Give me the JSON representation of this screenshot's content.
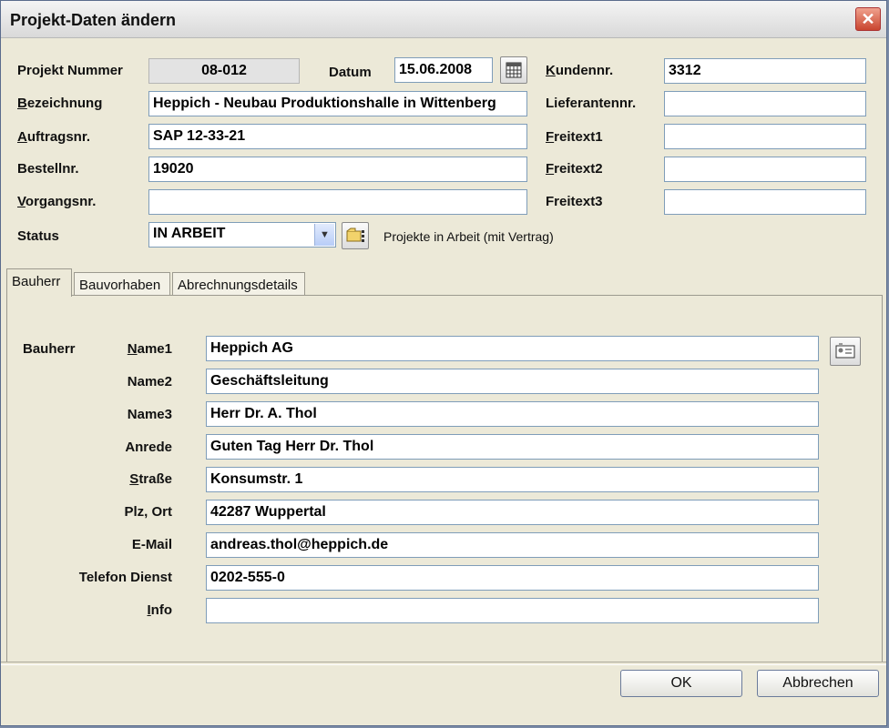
{
  "window": {
    "title": "Projekt-Daten ändern",
    "close_glyph": "✕"
  },
  "project": {
    "nummer_label": "Projekt Nummer",
    "nummer_value": "08-012",
    "datum_label": "Datum",
    "datum_value": "15.06.2008",
    "kundennr_label": "Kundennr.",
    "kundennr_value": "3312",
    "bezeichnung_label": "Bezeichnung",
    "bezeichnung_value": "Heppich - Neubau Produktionshalle in Wittenberg",
    "lieferantennr_label": "Lieferantennr.",
    "lieferantennr_value": "",
    "auftragsnr_label": "Auftragsnr.",
    "auftragsnr_value": "SAP 12-33-21",
    "freitext1_label": "Freitext1",
    "freitext1_value": "",
    "bestellnr_label": "Bestellnr.",
    "bestellnr_value": "19020",
    "freitext2_label": "Freitext2",
    "freitext2_value": "",
    "vorgangsnr_label": "Vorgangsnr.",
    "vorgangsnr_value": "",
    "freitext3_label": "Freitext3",
    "freitext3_value": "",
    "status_label": "Status",
    "status_value": "IN ARBEIT",
    "status_note": "Projekte in Arbeit (mit Vertrag)"
  },
  "tabs": [
    {
      "label": "Bauherr",
      "active": true
    },
    {
      "label": "Bauvorhaben",
      "active": false
    },
    {
      "label": "Abrechnungsdetails",
      "active": false
    }
  ],
  "bauherr": {
    "section_label": "Bauherr",
    "fields": [
      {
        "label": "Name1",
        "value": "Heppich AG"
      },
      {
        "label": "Name2",
        "value": "Geschäftsleitung"
      },
      {
        "label": "Name3",
        "value": "Herr Dr. A. Thol"
      },
      {
        "label": "Anrede",
        "value": "Guten Tag Herr Dr. Thol"
      },
      {
        "label": "Straße",
        "value": "Konsumstr. 1"
      },
      {
        "label": "Plz, Ort",
        "value": "42287 Wuppertal"
      },
      {
        "label": "E-Mail",
        "value": "andreas.thol@heppich.de"
      },
      {
        "label": "Telefon Dienst",
        "value": "0202-555-0"
      },
      {
        "label": "Info",
        "value": ""
      }
    ]
  },
  "buttons": {
    "ok": "OK",
    "cancel": "Abbrechen"
  },
  "icons": {
    "calendar": "calendar-icon",
    "status_lookup": "folder-hand-icon",
    "address_book": "address-card-icon",
    "dropdown": "chevron-down-icon"
  }
}
